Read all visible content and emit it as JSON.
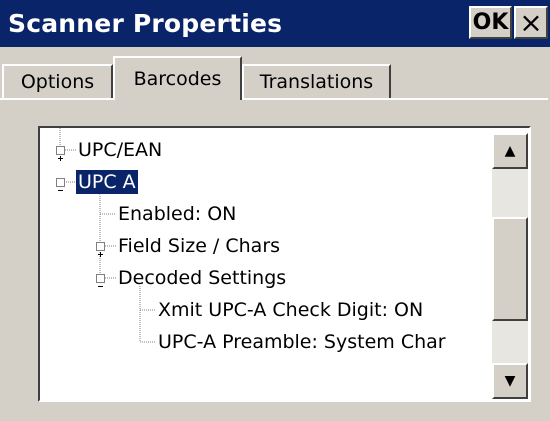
{
  "window": {
    "title": "Scanner Properties",
    "ok_label": "OK",
    "close_label": "×"
  },
  "tabs": [
    {
      "label": "Options",
      "active": false
    },
    {
      "label": "Barcodes",
      "active": true
    },
    {
      "label": "Translations",
      "active": false
    }
  ],
  "tree": {
    "items": [
      {
        "label": "UPC/EAN",
        "expanded": false
      },
      {
        "label": "UPC A",
        "expanded": true,
        "selected": true
      },
      {
        "label": "Enabled: ON"
      },
      {
        "label": "Field Size / Chars",
        "expanded": false
      },
      {
        "label": "Decoded Settings",
        "expanded": true
      },
      {
        "label": "Xmit UPC-A Check Digit: ON"
      },
      {
        "label": "UPC-A Preamble: System Char"
      }
    ]
  },
  "scrollbar": {
    "up_icon": "▲",
    "down_icon": "▼"
  },
  "colors": {
    "titlebar": "#0a246a",
    "face": "#d4d0c8",
    "selection": "#0a246a"
  }
}
